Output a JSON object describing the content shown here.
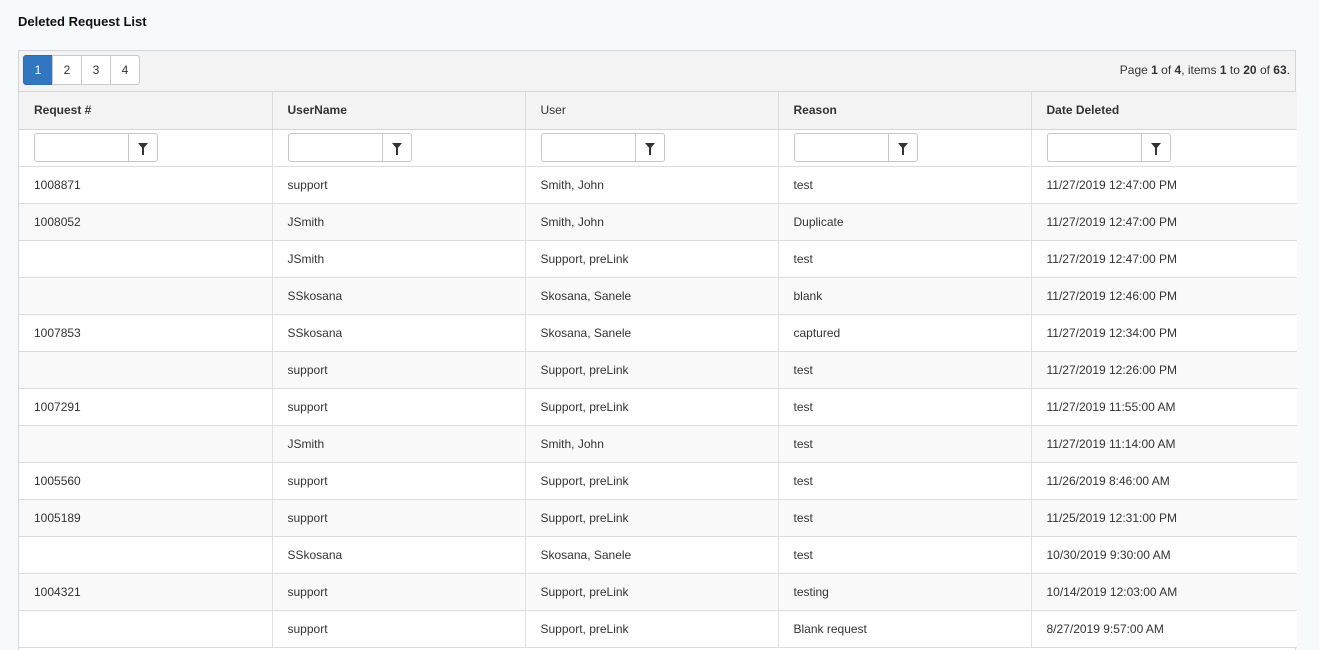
{
  "title": "Deleted Request List",
  "pager": {
    "pages": [
      "1",
      "2",
      "3",
      "4"
    ],
    "active_page": "1",
    "info": {
      "prefix": "Page ",
      "page": "1",
      "of_label": " of ",
      "total_pages": "4",
      "items_label": ", items ",
      "from": "1",
      "to_label": " to ",
      "to": "20",
      "of_items_label": " of ",
      "total_items": "63",
      "suffix": "."
    }
  },
  "columns": [
    "Request #",
    "UserName",
    "User",
    "Reason",
    "Date Deleted"
  ],
  "rows": [
    [
      "1008871",
      "support",
      "Smith, John",
      "test",
      "11/27/2019 12:47:00 PM"
    ],
    [
      "1008052",
      "JSmith",
      "Smith, John",
      "Duplicate",
      "11/27/2019 12:47:00 PM"
    ],
    [
      "",
      "JSmith",
      "Support, preLink",
      "test",
      "11/27/2019 12:47:00 PM"
    ],
    [
      "",
      "SSkosana",
      "Skosana, Sanele",
      "blank",
      "11/27/2019 12:46:00 PM"
    ],
    [
      "1007853",
      "SSkosana",
      "Skosana, Sanele",
      "captured",
      "11/27/2019 12:34:00 PM"
    ],
    [
      "",
      "support",
      "Support, preLink",
      "test",
      "11/27/2019 12:26:00 PM"
    ],
    [
      "1007291",
      "support",
      "Support, preLink",
      "test",
      "11/27/2019 11:55:00 AM"
    ],
    [
      "",
      "JSmith",
      "Smith, John",
      "test",
      "11/27/2019 11:14:00 AM"
    ],
    [
      "1005560",
      "support",
      "Support, preLink",
      "test",
      "11/26/2019 8:46:00 AM"
    ],
    [
      "1005189",
      "support",
      "Support, preLink",
      "test",
      "11/25/2019 12:31:00 PM"
    ],
    [
      "",
      "SSkosana",
      "Skosana, Sanele",
      "test",
      "10/30/2019 9:30:00 AM"
    ],
    [
      "1004321",
      "support",
      "Support, preLink",
      "testing",
      "10/14/2019 12:03:00 AM"
    ],
    [
      "",
      "support",
      "Support, preLink",
      "Blank request",
      "8/27/2019 9:57:00 AM"
    ]
  ],
  "icons": {
    "filter": "filter-funnel-icon"
  },
  "colors": {
    "active_page": "#3176bf",
    "header_bg": "#f3f3f3"
  }
}
